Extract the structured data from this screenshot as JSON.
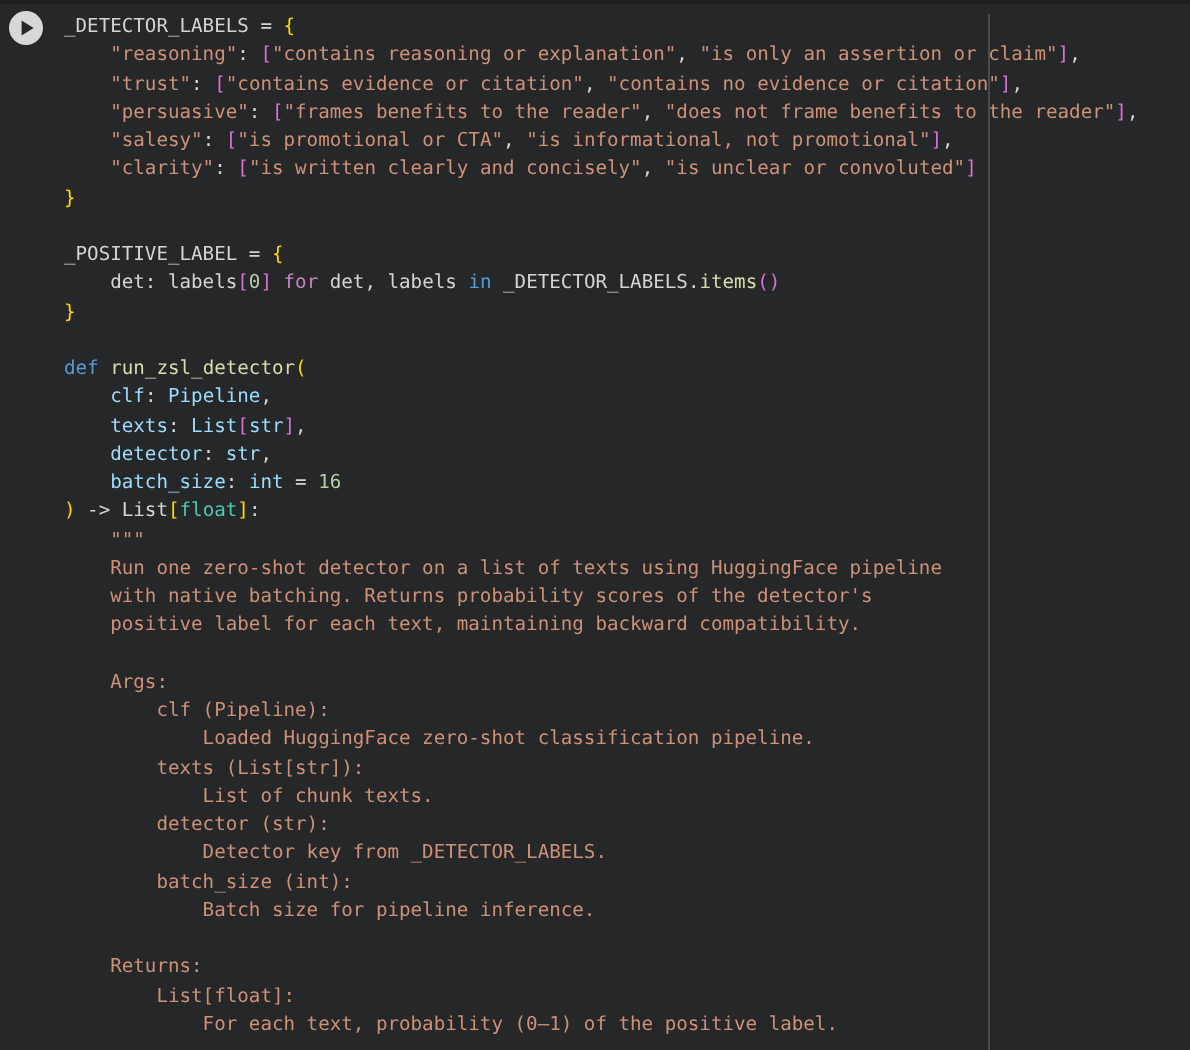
{
  "code_cell": {
    "lines": [
      {
        "kind": "code",
        "tokens": [
          {
            "kind": "plain",
            "text": "_DETECTOR_LABELS = "
          },
          {
            "kind": "bracket1",
            "text": "{"
          }
        ]
      },
      {
        "kind": "code",
        "tokens": [
          {
            "kind": "string",
            "text": "    \"reasoning\""
          },
          {
            "kind": "plain",
            "text": ": "
          },
          {
            "kind": "bracket2",
            "text": "["
          },
          {
            "kind": "string",
            "text": "\"contains reasoning or explanation\""
          },
          {
            "kind": "plain",
            "text": ", "
          },
          {
            "kind": "string",
            "text": "\"is only an assertion or claim\""
          },
          {
            "kind": "bracket2",
            "text": "]"
          },
          {
            "kind": "plain",
            "text": ","
          }
        ]
      },
      {
        "kind": "code",
        "tokens": [
          {
            "kind": "string",
            "text": "    \"trust\""
          },
          {
            "kind": "plain",
            "text": ": "
          },
          {
            "kind": "bracket2",
            "text": "["
          },
          {
            "kind": "string",
            "text": "\"contains evidence or citation\""
          },
          {
            "kind": "plain",
            "text": ", "
          },
          {
            "kind": "string",
            "text": "\"contains no evidence or citation\""
          },
          {
            "kind": "bracket2",
            "text": "]"
          },
          {
            "kind": "plain",
            "text": ","
          }
        ]
      },
      {
        "kind": "code",
        "tokens": [
          {
            "kind": "string",
            "text": "    \"persuasive\""
          },
          {
            "kind": "plain",
            "text": ": "
          },
          {
            "kind": "bracket2",
            "text": "["
          },
          {
            "kind": "string",
            "text": "\"frames benefits to the reader\""
          },
          {
            "kind": "plain",
            "text": ", "
          },
          {
            "kind": "string",
            "text": "\"does not frame benefits to the reader\""
          },
          {
            "kind": "bracket2",
            "text": "]"
          },
          {
            "kind": "plain",
            "text": ","
          }
        ]
      },
      {
        "kind": "code",
        "tokens": [
          {
            "kind": "string",
            "text": "    \"salesy\""
          },
          {
            "kind": "plain",
            "text": ": "
          },
          {
            "kind": "bracket2",
            "text": "["
          },
          {
            "kind": "string",
            "text": "\"is promotional or CTA\""
          },
          {
            "kind": "plain",
            "text": ", "
          },
          {
            "kind": "string",
            "text": "\"is informational, not promotional\""
          },
          {
            "kind": "bracket2",
            "text": "]"
          },
          {
            "kind": "plain",
            "text": ","
          }
        ]
      },
      {
        "kind": "code",
        "tokens": [
          {
            "kind": "string",
            "text": "    \"clarity\""
          },
          {
            "kind": "plain",
            "text": ": "
          },
          {
            "kind": "bracket2",
            "text": "["
          },
          {
            "kind": "string",
            "text": "\"is written clearly and concisely\""
          },
          {
            "kind": "plain",
            "text": ", "
          },
          {
            "kind": "string",
            "text": "\"is unclear or convoluted\""
          },
          {
            "kind": "bracket2",
            "text": "]"
          }
        ]
      },
      {
        "kind": "code",
        "tokens": [
          {
            "kind": "bracket1",
            "text": "}"
          }
        ]
      },
      {
        "kind": "blank"
      },
      {
        "kind": "code",
        "tokens": [
          {
            "kind": "plain",
            "text": "_POSITIVE_LABEL = "
          },
          {
            "kind": "bracket1",
            "text": "{"
          }
        ]
      },
      {
        "kind": "code",
        "tokens": [
          {
            "kind": "plain",
            "text": "    det: labels"
          },
          {
            "kind": "bracket2",
            "text": "["
          },
          {
            "kind": "number",
            "text": "0"
          },
          {
            "kind": "bracket2",
            "text": "] "
          },
          {
            "kind": "control",
            "text": "for"
          },
          {
            "kind": "plain",
            "text": " det, labels "
          },
          {
            "kind": "keyword",
            "text": "in"
          },
          {
            "kind": "plain",
            "text": " _DETECTOR_LABELS."
          },
          {
            "kind": "function",
            "text": "items"
          },
          {
            "kind": "bracket2",
            "text": "()"
          }
        ]
      },
      {
        "kind": "code",
        "tokens": [
          {
            "kind": "bracket1",
            "text": "}"
          }
        ]
      },
      {
        "kind": "blank"
      },
      {
        "kind": "code",
        "tokens": [
          {
            "kind": "keyword",
            "text": "def "
          },
          {
            "kind": "function",
            "text": "run_zsl_detector"
          },
          {
            "kind": "bracket1",
            "text": "("
          }
        ]
      },
      {
        "kind": "code",
        "tokens": [
          {
            "kind": "param",
            "text": "    clf"
          },
          {
            "kind": "plain",
            "text": ": "
          },
          {
            "kind": "type",
            "text": "Pipeline"
          },
          {
            "kind": "plain",
            "text": ","
          }
        ]
      },
      {
        "kind": "code",
        "tokens": [
          {
            "kind": "param",
            "text": "    texts"
          },
          {
            "kind": "plain",
            "text": ": "
          },
          {
            "kind": "type",
            "text": "List"
          },
          {
            "kind": "bracket2",
            "text": "["
          },
          {
            "kind": "type",
            "text": "str"
          },
          {
            "kind": "bracket2",
            "text": "]"
          },
          {
            "kind": "plain",
            "text": ","
          }
        ]
      },
      {
        "kind": "code",
        "tokens": [
          {
            "kind": "param",
            "text": "    detector"
          },
          {
            "kind": "plain",
            "text": ": "
          },
          {
            "kind": "type",
            "text": "str"
          },
          {
            "kind": "plain",
            "text": ","
          }
        ]
      },
      {
        "kind": "code",
        "tokens": [
          {
            "kind": "param",
            "text": "    batch_size"
          },
          {
            "kind": "plain",
            "text": ": "
          },
          {
            "kind": "type",
            "text": "int"
          },
          {
            "kind": "plain",
            "text": " = "
          },
          {
            "kind": "number",
            "text": "16"
          }
        ]
      },
      {
        "kind": "code",
        "tokens": [
          {
            "kind": "bracket1",
            "text": ")"
          },
          {
            "kind": "plain",
            "text": " -> List"
          },
          {
            "kind": "bracket1",
            "text": "["
          },
          {
            "kind": "class",
            "text": "float"
          },
          {
            "kind": "bracket1",
            "text": "]"
          },
          {
            "kind": "plain",
            "text": ":"
          }
        ]
      },
      {
        "kind": "code",
        "tokens": [
          {
            "kind": "string",
            "text": "    \"\"\""
          }
        ]
      },
      {
        "kind": "code",
        "tokens": [
          {
            "kind": "string",
            "text": "    Run one zero-shot detector on a list of texts using HuggingFace pipeline"
          }
        ]
      },
      {
        "kind": "code",
        "tokens": [
          {
            "kind": "string",
            "text": "    with native batching. Returns probability scores of the detector's"
          }
        ]
      },
      {
        "kind": "code",
        "tokens": [
          {
            "kind": "string",
            "text": "    positive label for each text, maintaining backward compatibility."
          }
        ]
      },
      {
        "kind": "blank"
      },
      {
        "kind": "code",
        "tokens": [
          {
            "kind": "string",
            "text": "    Args:"
          }
        ]
      },
      {
        "kind": "code",
        "tokens": [
          {
            "kind": "string",
            "text": "        clf (Pipeline):"
          }
        ]
      },
      {
        "kind": "code",
        "tokens": [
          {
            "kind": "string",
            "text": "            Loaded HuggingFace zero-shot classification pipeline."
          }
        ]
      },
      {
        "kind": "code",
        "tokens": [
          {
            "kind": "string",
            "text": "        texts (List[str]):"
          }
        ]
      },
      {
        "kind": "code",
        "tokens": [
          {
            "kind": "string",
            "text": "            List of chunk texts."
          }
        ]
      },
      {
        "kind": "code",
        "tokens": [
          {
            "kind": "string",
            "text": "        detector (str):"
          }
        ]
      },
      {
        "kind": "code",
        "tokens": [
          {
            "kind": "string",
            "text": "            Detector key from _DETECTOR_LABELS."
          }
        ]
      },
      {
        "kind": "code",
        "tokens": [
          {
            "kind": "string",
            "text": "        batch_size (int):"
          }
        ]
      },
      {
        "kind": "code",
        "tokens": [
          {
            "kind": "string",
            "text": "            Batch size for pipeline inference."
          }
        ]
      },
      {
        "kind": "blank"
      },
      {
        "kind": "code",
        "tokens": [
          {
            "kind": "string",
            "text": "    Returns:"
          }
        ]
      },
      {
        "kind": "code",
        "tokens": [
          {
            "kind": "string",
            "text": "        List[float]:"
          }
        ]
      },
      {
        "kind": "code",
        "tokens": [
          {
            "kind": "string",
            "text": "            For each text, probability (0–1) of the positive label."
          }
        ]
      }
    ]
  }
}
